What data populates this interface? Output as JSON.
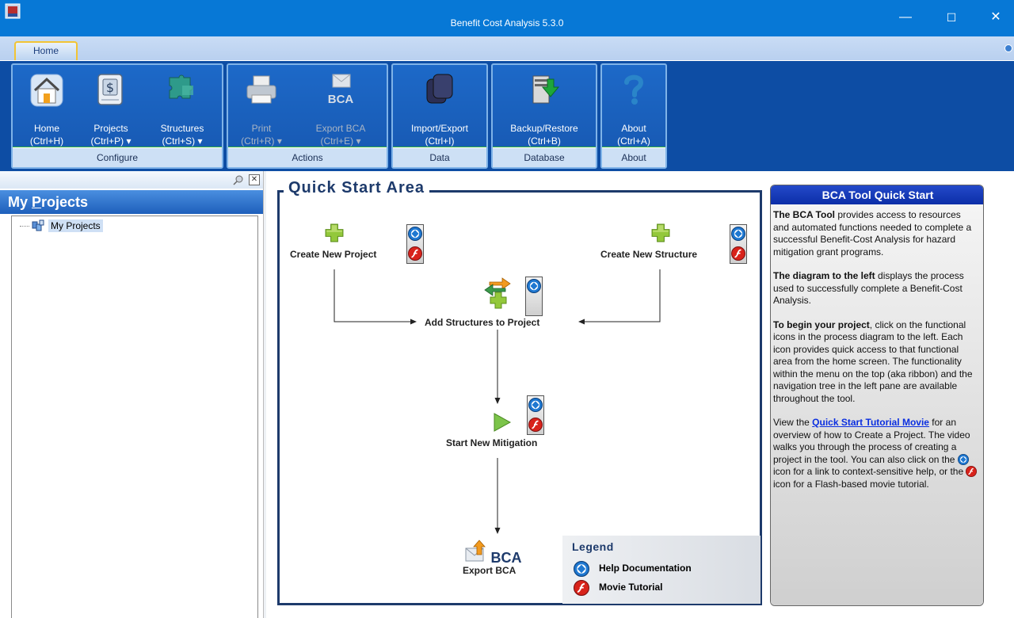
{
  "window": {
    "title": "Benefit Cost Analysis 5.3.0",
    "minimize": "—",
    "maximize": "☐",
    "close": "✕"
  },
  "tabs": [
    {
      "label": "Home"
    }
  ],
  "ribbon": {
    "groups": [
      {
        "caption": "Configure",
        "buttons": [
          {
            "l1": "Home",
            "l2": "(Ctrl+H)"
          },
          {
            "l1": "Projects",
            "l2": "(Ctrl+P) ▾"
          },
          {
            "l1": "Structures",
            "l2": "(Ctrl+S) ▾"
          }
        ]
      },
      {
        "caption": "Actions",
        "buttons": [
          {
            "l1": "Print",
            "l2": "(Ctrl+R) ▾"
          },
          {
            "l1": "Export BCA",
            "l2": "(Ctrl+E) ▾",
            "icon_text": "BCA"
          }
        ]
      },
      {
        "caption": "Data",
        "buttons": [
          {
            "l1": "Import/Export",
            "l2": "(Ctrl+I)"
          }
        ]
      },
      {
        "caption": "Database",
        "buttons": [
          {
            "l1": "Backup/Restore",
            "l2": "(Ctrl+B)"
          }
        ]
      },
      {
        "caption": "About",
        "buttons": [
          {
            "l1": "About",
            "l2": "(Ctrl+A)"
          }
        ]
      }
    ]
  },
  "left_pane": {
    "title_pre": "My ",
    "title_underlined": "P",
    "title_post": "rojects",
    "tree": [
      {
        "label": "My Projects"
      }
    ]
  },
  "quick_start": {
    "title": "Quick Start Area",
    "nodes": {
      "create_project": "Create New Project",
      "create_structure": "Create New Structure",
      "add_structures": "Add Structures to Project",
      "start_mitigation": "Start New Mitigation",
      "export_icon_text": "BCA",
      "export": "Export BCA"
    },
    "legend": {
      "title": "Legend",
      "help": "Help Documentation",
      "movie": "Movie Tutorial"
    }
  },
  "side_panel": {
    "title": "BCA Tool Quick Start",
    "p1_bold": "The BCA Tool",
    "p1_rest": " provides access to resources and automated functions needed to complete a successful Benefit-Cost Analysis for hazard mitigation grant programs.",
    "p2_bold": "The diagram to the left",
    "p2_rest": " displays the process used to successfully complete a Benefit-Cost Analysis.",
    "p3_bold": "To begin your project",
    "p3_rest": ", click on the functional icons in the process diagram to the left.  Each icon provides quick access to that functional area from the home screen. The functionality within the menu on the top (aka ribbon) and the navigation tree in the left pane are available throughout the tool.",
    "p4_pre": "View the ",
    "p4_link": "Quick Start Tutorial Movie",
    "p4_mid": " for an overview of how to Create a Project. The video walks you through the process of creating a project in the tool. You can also click on the ",
    "p4_mid2": " icon for a link to context-sensitive help, or the ",
    "p4_end": " icon for a Flash-based movie tutorial."
  },
  "colors": {
    "titlebar": "#0778d6",
    "ribbon_bg": "#0d4da4",
    "panel_header": "#0c2ea8",
    "accent_green": "#31b540",
    "help_blue": "#1f78d1",
    "movie_red": "#d8231b"
  }
}
